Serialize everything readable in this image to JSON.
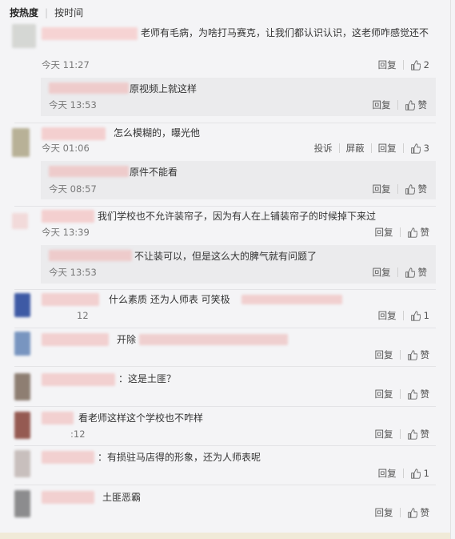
{
  "sort": {
    "hot": "按热度",
    "time": "按时间"
  },
  "labels": {
    "reply": "回复",
    "like": "赞",
    "report": "投诉",
    "block": "屏蔽"
  },
  "comments": [
    {
      "text": "老师有毛病，为啥打马赛克，让我们都认识认识，这老师咋感觉还不",
      "time": "今天 11:27",
      "likes": "2",
      "reply": {
        "text": "原视频上就这样",
        "time": "今天 13:53",
        "likes": "赞"
      }
    },
    {
      "text": "怎么模糊的，曝光他",
      "time": "今天 01:06",
      "likes": "3",
      "reply": {
        "text": "原件不能看",
        "time": "今天 08:57",
        "likes": "赞"
      }
    },
    {
      "text": "我们学校也不允许装帘子，因为有人在上铺装帘子的时候掉下来过",
      "time": "今天 13:39",
      "likes": "赞",
      "reply": {
        "text": "不让装可以，但是这么大的脾气就有问题了",
        "time": "今天 13:53",
        "likes": "赞"
      }
    },
    {
      "text": "什么素质 还为人师表 可笑极",
      "time": "12",
      "likes": "1"
    },
    {
      "text": "开除",
      "time": "",
      "likes": "赞"
    },
    {
      "text": "：这是土匪？",
      "time": "",
      "likes": "赞"
    },
    {
      "text": "看老师这样这个学校也不咋样",
      "time": ":12",
      "likes": "赞"
    },
    {
      "text": "：有损驻马店得的形象，还为人师表呢",
      "time": "",
      "likes": "1"
    },
    {
      "text": "土匪恶霸",
      "time": "",
      "likes": "赞"
    }
  ]
}
